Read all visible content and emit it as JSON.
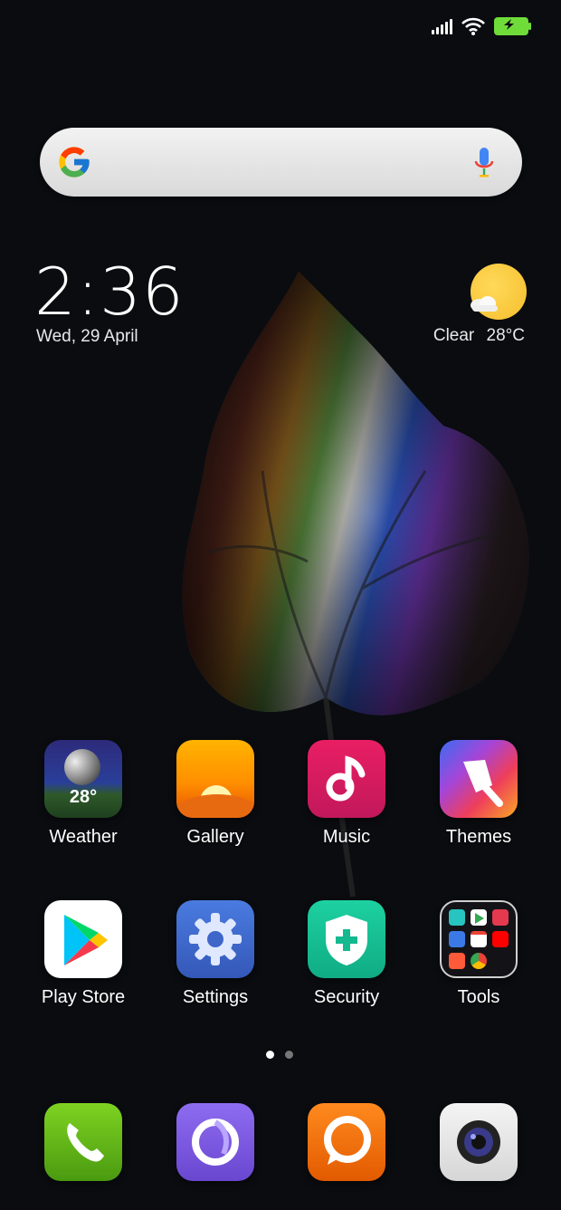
{
  "status_bar": {
    "icons": [
      "signal-icon",
      "wifi-icon",
      "battery-charging-icon"
    ]
  },
  "search": {
    "mic_icon": "mic-icon",
    "logo_icon": "google-icon"
  },
  "clock": {
    "time": "2:36",
    "date": "Wed, 29 April"
  },
  "weather_widget": {
    "condition": "Clear",
    "temperature": "28°C"
  },
  "apps_row1": [
    {
      "label": "Weather",
      "icon": "weather-icon",
      "badge": "28°"
    },
    {
      "label": "Gallery",
      "icon": "gallery-icon"
    },
    {
      "label": "Music",
      "icon": "music-icon"
    },
    {
      "label": "Themes",
      "icon": "themes-icon"
    }
  ],
  "apps_row2": [
    {
      "label": "Play Store",
      "icon": "play-store-icon"
    },
    {
      "label": "Settings",
      "icon": "settings-icon"
    },
    {
      "label": "Security",
      "icon": "security-icon"
    },
    {
      "label": "Tools",
      "icon": "tools-folder-icon"
    }
  ],
  "page_indicator": {
    "pages": 2,
    "current": 1
  },
  "dock": [
    {
      "icon": "phone-icon"
    },
    {
      "icon": "browser-icon"
    },
    {
      "icon": "messaging-icon"
    },
    {
      "icon": "camera-icon"
    }
  ],
  "colors": {
    "background": "#0a0c10",
    "battery": "#6fdc3a"
  }
}
